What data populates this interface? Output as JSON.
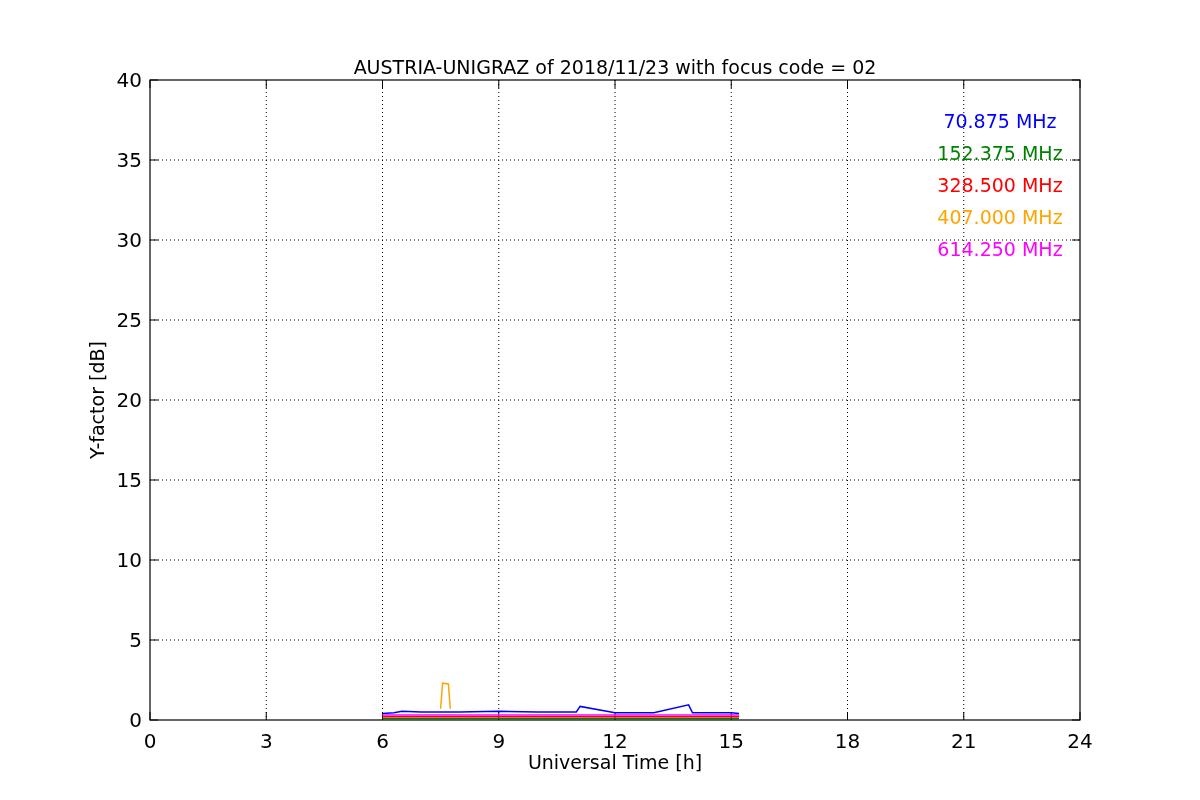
{
  "chart_data": {
    "type": "line",
    "title": "AUSTRIA-UNIGRAZ of 2018/11/23 with focus code = 02",
    "xlabel": "Universal Time [h]",
    "ylabel": "Y-factor [dB]",
    "x": [
      6,
      6.3,
      6.5,
      7,
      7.5,
      7.55,
      7.7,
      7.75,
      8,
      9,
      10,
      11,
      11.1,
      12,
      13,
      13.9,
      14,
      15,
      15.2
    ],
    "series": [
      {
        "name": "70.875 MHz",
        "color": "#0000ff",
        "values": [
          0.4,
          0.45,
          0.55,
          0.5,
          0.5,
          0.5,
          0.5,
          0.5,
          0.5,
          0.55,
          0.5,
          0.5,
          0.85,
          0.45,
          0.45,
          0.95,
          0.45,
          0.45,
          0.4
        ]
      },
      {
        "name": "152.375 MHz",
        "color": "#008000",
        "values": [
          0.1,
          0.1,
          0.1,
          0.1,
          0.1,
          0.1,
          0.1,
          0.1,
          0.1,
          0.1,
          0.1,
          0.1,
          0.1,
          0.1,
          0.1,
          0.1,
          0.1,
          0.1,
          0.1
        ]
      },
      {
        "name": "328.500 MHz",
        "color": "#ff0000",
        "values": [
          0.2,
          0.2,
          0.2,
          0.2,
          0.2,
          0.2,
          0.2,
          0.2,
          0.2,
          0.2,
          0.2,
          0.2,
          0.2,
          0.2,
          0.2,
          0.2,
          0.2,
          0.2,
          0.2
        ]
      },
      {
        "name": "407.000 MHz",
        "color": "#ffa500",
        "values": [
          null,
          null,
          null,
          null,
          0.7,
          2.3,
          2.25,
          0.7,
          null,
          null,
          null,
          null,
          null,
          null,
          null,
          null,
          null,
          null,
          null
        ]
      },
      {
        "name": "614.250 MHz",
        "color": "#ff00ff",
        "values": [
          0.32,
          0.32,
          0.32,
          0.32,
          0.32,
          0.32,
          0.32,
          0.32,
          0.32,
          0.32,
          0.32,
          0.32,
          0.32,
          0.32,
          0.32,
          0.32,
          0.32,
          0.32,
          0.32
        ]
      }
    ],
    "xlim": [
      0,
      24
    ],
    "ylim": [
      0,
      40
    ],
    "xticks": [
      0,
      3,
      6,
      9,
      12,
      15,
      18,
      21,
      24
    ],
    "yticks": [
      0,
      5,
      10,
      15,
      20,
      25,
      30,
      35,
      40
    ],
    "grid": true
  }
}
